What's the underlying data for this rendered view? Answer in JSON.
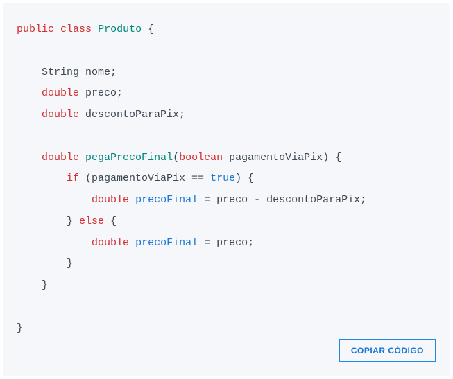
{
  "code": {
    "tokens": [
      {
        "t": "public",
        "c": "kw-red"
      },
      {
        "t": " "
      },
      {
        "t": "class",
        "c": "kw-red"
      },
      {
        "t": " "
      },
      {
        "t": "Produto",
        "c": "kw-teal"
      },
      {
        "t": " {\n\n"
      },
      {
        "t": "    String nome;\n"
      },
      {
        "t": "    "
      },
      {
        "t": "double",
        "c": "kw-red"
      },
      {
        "t": " preco;\n"
      },
      {
        "t": "    "
      },
      {
        "t": "double",
        "c": "kw-red"
      },
      {
        "t": " descontoParaPix;\n\n"
      },
      {
        "t": "    "
      },
      {
        "t": "double",
        "c": "kw-red"
      },
      {
        "t": " "
      },
      {
        "t": "pegaPrecoFinal",
        "c": "kw-teal"
      },
      {
        "t": "("
      },
      {
        "t": "boolean",
        "c": "kw-red"
      },
      {
        "t": " pagamentoViaPix)"
      },
      {
        "t": " {\n"
      },
      {
        "t": "        "
      },
      {
        "t": "if",
        "c": "kw-red"
      },
      {
        "t": " (pagamentoViaPix == "
      },
      {
        "t": "true",
        "c": "kw-blue"
      },
      {
        "t": ") {\n"
      },
      {
        "t": "            "
      },
      {
        "t": "double",
        "c": "kw-red"
      },
      {
        "t": " "
      },
      {
        "t": "precoFinal",
        "c": "kw-blue"
      },
      {
        "t": " = preco - descontoParaPix;\n"
      },
      {
        "t": "        } "
      },
      {
        "t": "else",
        "c": "kw-red"
      },
      {
        "t": " {\n"
      },
      {
        "t": "            "
      },
      {
        "t": "double",
        "c": "kw-red"
      },
      {
        "t": " "
      },
      {
        "t": "precoFinal",
        "c": "kw-blue"
      },
      {
        "t": " = preco;\n"
      },
      {
        "t": "        }\n"
      },
      {
        "t": "    }\n\n"
      },
      {
        "t": "}"
      }
    ]
  },
  "button": {
    "copy_label": "COPIAR CÓDIGO"
  }
}
